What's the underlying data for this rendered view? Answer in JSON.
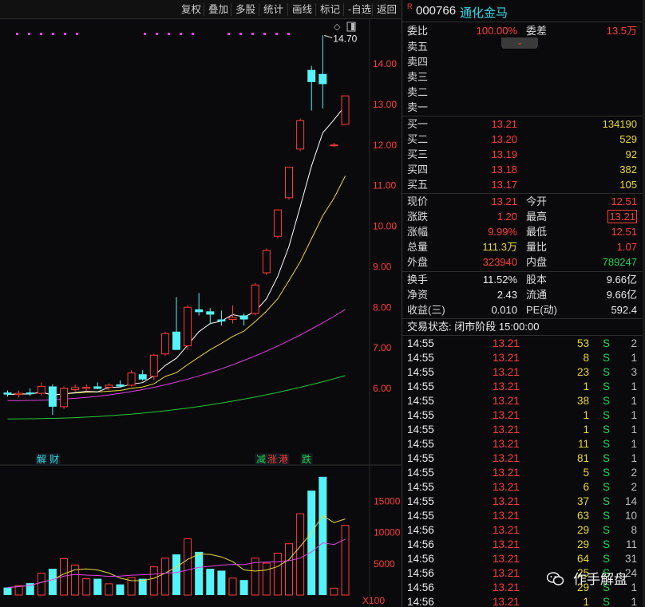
{
  "toolbar": {
    "buttons": [
      "复权",
      "叠加",
      "多股",
      "统计",
      "画线",
      "标记",
      "-自选",
      "返回"
    ]
  },
  "kline": {
    "price_axis": [
      "14.00",
      "13.00",
      "12.00",
      "11.00",
      "10.00",
      "9.00",
      "8.00",
      "7.00",
      "6.00"
    ],
    "vol_axis": [
      "15000",
      "10000",
      "5000"
    ],
    "vol_unit": "X100",
    "max_label": "14.70",
    "events": [
      {
        "label": "解财",
        "color": "#36d8e8"
      },
      {
        "label": "减",
        "color": "#22d35a"
      },
      {
        "label": "涨",
        "color": "#ff3b3b"
      },
      {
        "label": "港",
        "color": "#ff3b3b"
      },
      {
        "label": "跌",
        "color": "#22d35a"
      }
    ],
    "colors": {
      "up": "#ff3b3b",
      "down": "#54f4f8",
      "ma5": "#ffffff",
      "ma10": "#e8d83a",
      "ma20": "#e040e0",
      "ma60": "#22c83a",
      "bg": "#0a0a0c"
    }
  },
  "chart_data": {
    "type": "candlestick",
    "candles": [
      {
        "o": 5.9,
        "h": 5.95,
        "l": 5.8,
        "c": 5.85,
        "v": 1200
      },
      {
        "o": 5.85,
        "h": 5.95,
        "l": 5.78,
        "c": 5.88,
        "v": 1500
      },
      {
        "o": 5.9,
        "h": 6.0,
        "l": 5.82,
        "c": 5.86,
        "v": 1900
      },
      {
        "o": 5.88,
        "h": 6.15,
        "l": 5.83,
        "c": 6.05,
        "v": 3500
      },
      {
        "o": 6.05,
        "h": 6.1,
        "l": 5.35,
        "c": 5.55,
        "v": 4200
      },
      {
        "o": 5.55,
        "h": 6.05,
        "l": 5.5,
        "c": 6.0,
        "v": 5800
      },
      {
        "o": 5.97,
        "h": 6.1,
        "l": 5.92,
        "c": 6.02,
        "v": 4800
      },
      {
        "o": 6.0,
        "h": 6.1,
        "l": 5.93,
        "c": 6.03,
        "v": 2600
      },
      {
        "o": 6.05,
        "h": 6.15,
        "l": 5.98,
        "c": 5.99,
        "v": 2600
      },
      {
        "o": 6.03,
        "h": 6.12,
        "l": 5.95,
        "c": 6.08,
        "v": 1800
      },
      {
        "o": 6.1,
        "h": 6.2,
        "l": 6.02,
        "c": 6.05,
        "v": 1700
      },
      {
        "o": 6.08,
        "h": 6.45,
        "l": 6.05,
        "c": 6.38,
        "v": 2800
      },
      {
        "o": 6.35,
        "h": 6.45,
        "l": 6.2,
        "c": 6.22,
        "v": 2600
      },
      {
        "o": 6.3,
        "h": 6.85,
        "l": 6.2,
        "c": 6.82,
        "v": 4500
      },
      {
        "o": 6.85,
        "h": 7.4,
        "l": 6.8,
        "c": 7.35,
        "v": 5900
      },
      {
        "o": 7.4,
        "h": 8.25,
        "l": 6.95,
        "c": 6.95,
        "v": 6500
      },
      {
        "o": 7.05,
        "h": 8.05,
        "l": 6.95,
        "c": 8.0,
        "v": 9000
      },
      {
        "o": 7.95,
        "h": 8.35,
        "l": 7.8,
        "c": 7.88,
        "v": 6900
      },
      {
        "o": 7.9,
        "h": 7.98,
        "l": 7.58,
        "c": 7.82,
        "v": 4200
      },
      {
        "o": 7.7,
        "h": 7.92,
        "l": 7.55,
        "c": 7.65,
        "v": 3900
      },
      {
        "o": 7.7,
        "h": 8.05,
        "l": 7.6,
        "c": 7.75,
        "v": 2700
      },
      {
        "o": 7.8,
        "h": 7.85,
        "l": 7.55,
        "c": 7.7,
        "v": 2400
      },
      {
        "o": 7.85,
        "h": 8.6,
        "l": 7.8,
        "c": 8.55,
        "v": 5900
      },
      {
        "o": 8.85,
        "h": 9.45,
        "l": 8.8,
        "c": 9.4,
        "v": 5100
      },
      {
        "o": 9.75,
        "h": 10.4,
        "l": 9.7,
        "c": 10.4,
        "v": 6700
      },
      {
        "o": 10.7,
        "h": 11.45,
        "l": 10.65,
        "c": 11.45,
        "v": 8200
      },
      {
        "o": 11.9,
        "h": 12.65,
        "l": 11.85,
        "c": 12.6,
        "v": 13000
      },
      {
        "o": 13.85,
        "h": 13.95,
        "l": 12.85,
        "c": 13.55,
        "v": 16700
      },
      {
        "o": 13.75,
        "h": 14.7,
        "l": 12.9,
        "c": 13.5,
        "v": 18900
      },
      {
        "o": 12.0,
        "h": 12.05,
        "l": 11.95,
        "c": 12.0,
        "v": 1100
      },
      {
        "o": 12.51,
        "h": 13.21,
        "l": 12.51,
        "c": 13.21,
        "v": 11130
      }
    ]
  },
  "quote": {
    "code": "000766",
    "name": "通化金马",
    "weibi_label": "委比",
    "weibi": "100.00%",
    "weicha_label": "委差",
    "weicha": "13.5万",
    "sell": [
      {
        "label": "卖五",
        "price": "",
        "vol": ""
      },
      {
        "label": "卖四",
        "price": "",
        "vol": ""
      },
      {
        "label": "卖三",
        "price": "",
        "vol": ""
      },
      {
        "label": "卖二",
        "price": "",
        "vol": ""
      },
      {
        "label": "卖一",
        "price": "",
        "vol": ""
      }
    ],
    "buy": [
      {
        "label": "买一",
        "price": "13.21",
        "vol": "134190"
      },
      {
        "label": "买二",
        "price": "13.20",
        "vol": "529"
      },
      {
        "label": "买三",
        "price": "13.19",
        "vol": "92"
      },
      {
        "label": "买四",
        "price": "13.18",
        "vol": "382"
      },
      {
        "label": "买五",
        "price": "13.17",
        "vol": "105"
      }
    ],
    "stats1": [
      {
        "l1": "现价",
        "v1": "13.21",
        "c1": "red",
        "l2": "今开",
        "v2": "12.51",
        "c2": "red"
      },
      {
        "l1": "涨跌",
        "v1": "1.20",
        "c1": "red",
        "l2": "最高",
        "v2": "13.21",
        "c2": "red"
      },
      {
        "l1": "涨幅",
        "v1": "9.99%",
        "c1": "red",
        "l2": "最低",
        "v2": "12.51",
        "c2": "red"
      },
      {
        "l1": "总量",
        "v1": "111.3万",
        "c1": "yellow",
        "l2": "量比",
        "v2": "1.07",
        "c2": "red"
      },
      {
        "l1": "外盘",
        "v1": "323940",
        "c1": "red",
        "l2": "内盘",
        "v2": "789247",
        "c2": "green"
      }
    ],
    "stats2": [
      {
        "l1": "换手",
        "v1": "11.52%",
        "l2": "股本",
        "v2": "9.66亿"
      },
      {
        "l1": "净资",
        "v1": "2.43",
        "l2": "流通",
        "v2": "9.66亿"
      },
      {
        "l1": "收益(三)",
        "v1": "0.010",
        "l2": "PE(动)",
        "v2": "592.4"
      }
    ],
    "status": "交易状态: 闭市阶段 15:00:00"
  },
  "ticks": [
    {
      "t": "14:55",
      "p": "13.21",
      "v": "53",
      "s": "S",
      "n": "2"
    },
    {
      "t": "14:55",
      "p": "13.21",
      "v": "8",
      "s": "S",
      "n": "1"
    },
    {
      "t": "14:55",
      "p": "13.21",
      "v": "23",
      "s": "S",
      "n": "3"
    },
    {
      "t": "14:55",
      "p": "13.21",
      "v": "1",
      "s": "S",
      "n": "1"
    },
    {
      "t": "14:55",
      "p": "13.21",
      "v": "38",
      "s": "S",
      "n": "1"
    },
    {
      "t": "14:55",
      "p": "13.21",
      "v": "1",
      "s": "S",
      "n": "1"
    },
    {
      "t": "14:55",
      "p": "13.21",
      "v": "1",
      "s": "S",
      "n": "1"
    },
    {
      "t": "14:55",
      "p": "13.21",
      "v": "11",
      "s": "S",
      "n": "1"
    },
    {
      "t": "14:55",
      "p": "13.21",
      "v": "81",
      "s": "S",
      "n": "1"
    },
    {
      "t": "14:55",
      "p": "13.21",
      "v": "5",
      "s": "S",
      "n": "2"
    },
    {
      "t": "14:55",
      "p": "13.21",
      "v": "6",
      "s": "S",
      "n": "2"
    },
    {
      "t": "14:55",
      "p": "13.21",
      "v": "37",
      "s": "S",
      "n": "14"
    },
    {
      "t": "14:55",
      "p": "13.21",
      "v": "63",
      "s": "S",
      "n": "10"
    },
    {
      "t": "14:56",
      "p": "13.21",
      "v": "29",
      "s": "S",
      "n": "8"
    },
    {
      "t": "14:56",
      "p": "13.21",
      "v": "29",
      "s": "S",
      "n": "11"
    },
    {
      "t": "14:56",
      "p": "13.21",
      "v": "64",
      "s": "S",
      "n": "31"
    },
    {
      "t": "14:56",
      "p": "13.21",
      "v": "25",
      "s": "S",
      "n": "24"
    },
    {
      "t": "14:56",
      "p": "13.21",
      "v": "29",
      "s": "S",
      "n": "1"
    },
    {
      "t": "14:56",
      "p": "13.21",
      "v": "1",
      "s": "S",
      "n": "1"
    }
  ],
  "watermark": "作手解盘"
}
